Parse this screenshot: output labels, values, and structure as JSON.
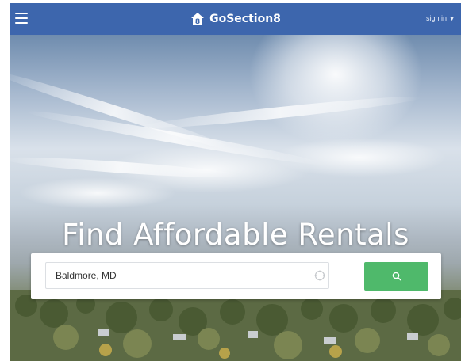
{
  "header": {
    "brand_name": "GoSection8",
    "menu_icon": "hamburger-menu-icon",
    "logo_icon": "house-8-logo-icon",
    "signin_label": "sign in",
    "signin_caret_icon": "caret-down-icon",
    "bar_color": "#3d66ad"
  },
  "hero": {
    "title": "Find Affordable Rentals"
  },
  "search": {
    "value": "Baldmore, MD",
    "locate_icon": "locate-target-icon",
    "button_icon": "search-icon",
    "button_color": "#4fb96b"
  }
}
